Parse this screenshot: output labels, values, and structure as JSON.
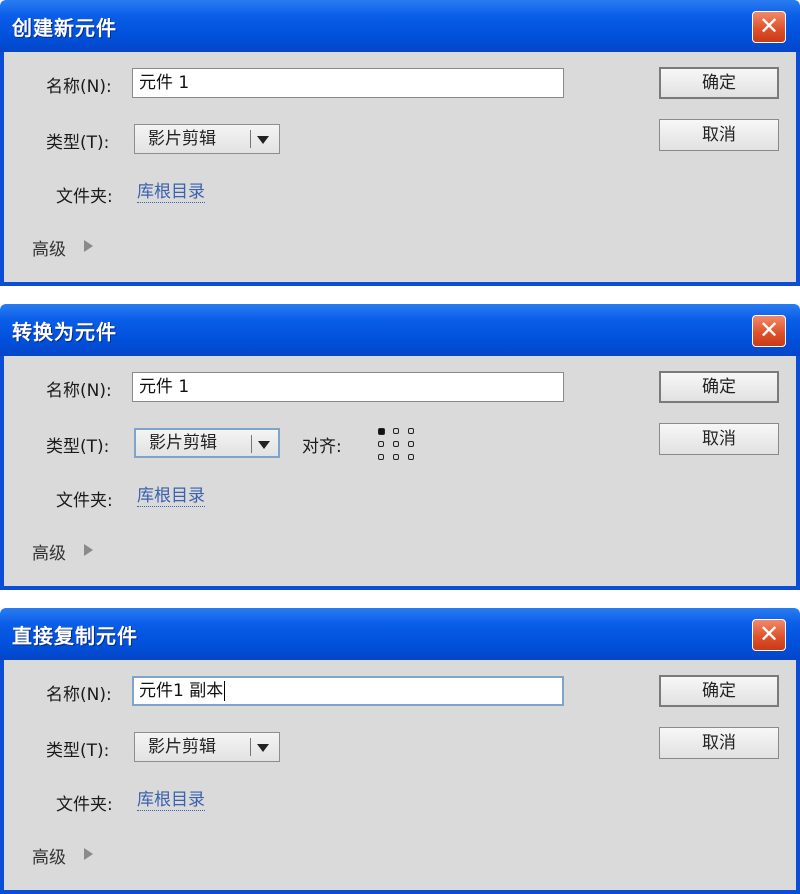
{
  "dialogs": [
    {
      "title": "创建新元件",
      "close_glyph": "✕",
      "name_label": "名称(N):",
      "name_value": "元件 1",
      "type_label": "类型(T):",
      "type_value": "影片剪辑",
      "folder_label": "文件夹:",
      "folder_value": "库根目录",
      "advanced_label": "高级",
      "ok_label": "确定",
      "cancel_label": "取消"
    },
    {
      "title": "转换为元件",
      "close_glyph": "✕",
      "name_label": "名称(N):",
      "name_value": "元件 1",
      "type_label": "类型(T):",
      "type_value": "影片剪辑",
      "align_label": "对齐:",
      "folder_label": "文件夹:",
      "folder_value": "库根目录",
      "advanced_label": "高级",
      "ok_label": "确定",
      "cancel_label": "取消"
    },
    {
      "title": "直接复制元件",
      "close_glyph": "✕",
      "name_label": "名称(N):",
      "name_value": "元件1 副本",
      "type_label": "类型(T):",
      "type_value": "影片剪辑",
      "folder_label": "文件夹:",
      "folder_value": "库根目录",
      "advanced_label": "高级",
      "ok_label": "确定",
      "cancel_label": "取消"
    }
  ],
  "icons": {
    "close": "close-icon",
    "dropdown": "chevron-down-icon",
    "advanced": "triangle-right-icon",
    "registration": "registration-grid-icon"
  },
  "colors": {
    "titlebar": "#0a5ee8",
    "dialog_body": "#dadada",
    "close_button": "#e0522e",
    "link": "#3b62b0"
  }
}
